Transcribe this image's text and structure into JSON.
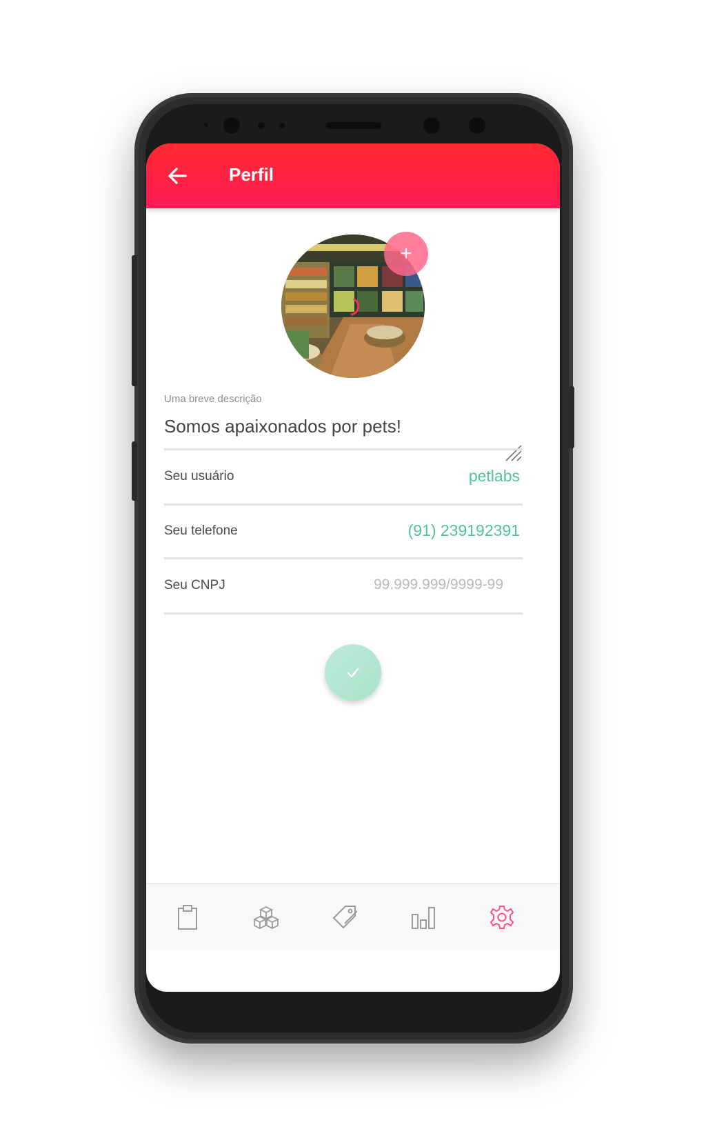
{
  "appbar": {
    "title": "Perfil",
    "back_icon": "arrow-left-icon"
  },
  "profile": {
    "add_photo_label": "+",
    "photo_subject": "pet-store-interior-photo"
  },
  "form": {
    "description_label": "Uma breve descrição",
    "description_value": "Somos apaixonados por pets!",
    "username_label": "Seu usuário",
    "username_value": "petlabs",
    "phone_label": "Seu telefone",
    "phone_value": "(91) 239192391",
    "cnpj_label": "Seu CNPJ",
    "cnpj_placeholder": "99.999.999/9999-99",
    "confirm_icon": "check-icon"
  },
  "bottom_nav": {
    "items": [
      {
        "icon": "clipboard-icon",
        "active": false
      },
      {
        "icon": "boxes-icon",
        "active": false
      },
      {
        "icon": "tag-icon",
        "active": false
      },
      {
        "icon": "bar-chart-icon",
        "active": false
      },
      {
        "icon": "gear-icon",
        "active": true
      }
    ]
  },
  "colors": {
    "appbar_top": "#ff2a2f",
    "appbar_bottom": "#ff1b56",
    "accent_green": "#4fc59b",
    "active_nav": "#ff4f86",
    "inactive_nav": "#9a9a9a"
  }
}
